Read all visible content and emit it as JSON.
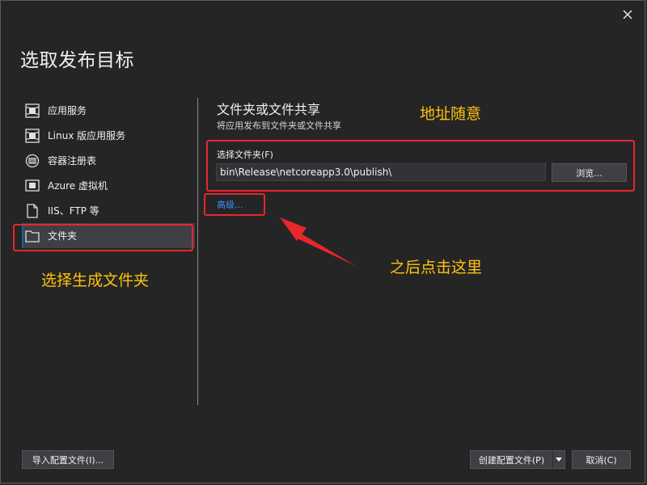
{
  "dialog": {
    "title": "选取发布目标",
    "close_icon": "close-icon"
  },
  "nav": {
    "items": [
      {
        "label": "应用服务",
        "icon": "app-service-icon"
      },
      {
        "label": "Linux 版应用服务",
        "icon": "linux-app-service-icon"
      },
      {
        "label": "容器注册表",
        "icon": "container-registry-icon"
      },
      {
        "label": "Azure 虚拟机",
        "icon": "azure-vm-icon"
      },
      {
        "label": "IIS、FTP 等",
        "icon": "iis-ftp-icon"
      },
      {
        "label": "文件夹",
        "icon": "folder-icon",
        "selected": true
      }
    ]
  },
  "panel": {
    "title": "文件夹或文件共享",
    "subtitle": "将应用发布到文件夹或文件共享",
    "folder_label": "选择文件夹(F)",
    "folder_value": "bin\\Release\\netcoreapp3.0\\publish\\",
    "browse_label": "浏览...",
    "advanced_link": "高级..."
  },
  "annotations": {
    "address_note": "地址随意",
    "folder_note": "选择生成文件夹",
    "click_note": "之后点击这里",
    "color": "#ffc20e",
    "box_color": "#e8262c"
  },
  "footer": {
    "import_label": "导入配置文件(I)...",
    "create_label": "创建配置文件(P)",
    "cancel_label": "取消(C)"
  }
}
